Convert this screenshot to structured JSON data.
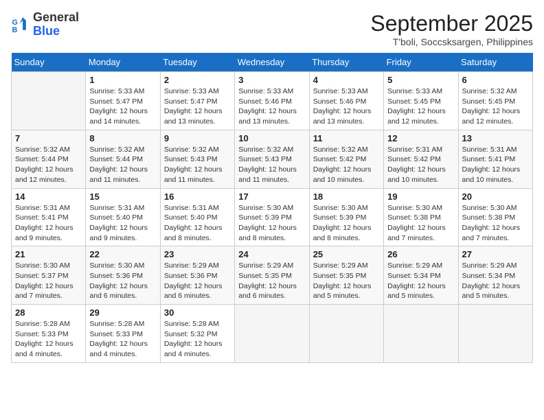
{
  "logo": {
    "line1": "General",
    "line2": "Blue"
  },
  "title": "September 2025",
  "subtitle": "T'boli, Soccsksargen, Philippines",
  "headers": [
    "Sunday",
    "Monday",
    "Tuesday",
    "Wednesday",
    "Thursday",
    "Friday",
    "Saturday"
  ],
  "weeks": [
    [
      {
        "day": "",
        "info": ""
      },
      {
        "day": "1",
        "info": "Sunrise: 5:33 AM\nSunset: 5:47 PM\nDaylight: 12 hours\nand 14 minutes."
      },
      {
        "day": "2",
        "info": "Sunrise: 5:33 AM\nSunset: 5:47 PM\nDaylight: 12 hours\nand 13 minutes."
      },
      {
        "day": "3",
        "info": "Sunrise: 5:33 AM\nSunset: 5:46 PM\nDaylight: 12 hours\nand 13 minutes."
      },
      {
        "day": "4",
        "info": "Sunrise: 5:33 AM\nSunset: 5:46 PM\nDaylight: 12 hours\nand 13 minutes."
      },
      {
        "day": "5",
        "info": "Sunrise: 5:33 AM\nSunset: 5:45 PM\nDaylight: 12 hours\nand 12 minutes."
      },
      {
        "day": "6",
        "info": "Sunrise: 5:32 AM\nSunset: 5:45 PM\nDaylight: 12 hours\nand 12 minutes."
      }
    ],
    [
      {
        "day": "7",
        "info": "Sunrise: 5:32 AM\nSunset: 5:44 PM\nDaylight: 12 hours\nand 12 minutes."
      },
      {
        "day": "8",
        "info": "Sunrise: 5:32 AM\nSunset: 5:44 PM\nDaylight: 12 hours\nand 11 minutes."
      },
      {
        "day": "9",
        "info": "Sunrise: 5:32 AM\nSunset: 5:43 PM\nDaylight: 12 hours\nand 11 minutes."
      },
      {
        "day": "10",
        "info": "Sunrise: 5:32 AM\nSunset: 5:43 PM\nDaylight: 12 hours\nand 11 minutes."
      },
      {
        "day": "11",
        "info": "Sunrise: 5:32 AM\nSunset: 5:42 PM\nDaylight: 12 hours\nand 10 minutes."
      },
      {
        "day": "12",
        "info": "Sunrise: 5:31 AM\nSunset: 5:42 PM\nDaylight: 12 hours\nand 10 minutes."
      },
      {
        "day": "13",
        "info": "Sunrise: 5:31 AM\nSunset: 5:41 PM\nDaylight: 12 hours\nand 10 minutes."
      }
    ],
    [
      {
        "day": "14",
        "info": "Sunrise: 5:31 AM\nSunset: 5:41 PM\nDaylight: 12 hours\nand 9 minutes."
      },
      {
        "day": "15",
        "info": "Sunrise: 5:31 AM\nSunset: 5:40 PM\nDaylight: 12 hours\nand 9 minutes."
      },
      {
        "day": "16",
        "info": "Sunrise: 5:31 AM\nSunset: 5:40 PM\nDaylight: 12 hours\nand 8 minutes."
      },
      {
        "day": "17",
        "info": "Sunrise: 5:30 AM\nSunset: 5:39 PM\nDaylight: 12 hours\nand 8 minutes."
      },
      {
        "day": "18",
        "info": "Sunrise: 5:30 AM\nSunset: 5:39 PM\nDaylight: 12 hours\nand 8 minutes."
      },
      {
        "day": "19",
        "info": "Sunrise: 5:30 AM\nSunset: 5:38 PM\nDaylight: 12 hours\nand 7 minutes."
      },
      {
        "day": "20",
        "info": "Sunrise: 5:30 AM\nSunset: 5:38 PM\nDaylight: 12 hours\nand 7 minutes."
      }
    ],
    [
      {
        "day": "21",
        "info": "Sunrise: 5:30 AM\nSunset: 5:37 PM\nDaylight: 12 hours\nand 7 minutes."
      },
      {
        "day": "22",
        "info": "Sunrise: 5:30 AM\nSunset: 5:36 PM\nDaylight: 12 hours\nand 6 minutes."
      },
      {
        "day": "23",
        "info": "Sunrise: 5:29 AM\nSunset: 5:36 PM\nDaylight: 12 hours\nand 6 minutes."
      },
      {
        "day": "24",
        "info": "Sunrise: 5:29 AM\nSunset: 5:35 PM\nDaylight: 12 hours\nand 6 minutes."
      },
      {
        "day": "25",
        "info": "Sunrise: 5:29 AM\nSunset: 5:35 PM\nDaylight: 12 hours\nand 5 minutes."
      },
      {
        "day": "26",
        "info": "Sunrise: 5:29 AM\nSunset: 5:34 PM\nDaylight: 12 hours\nand 5 minutes."
      },
      {
        "day": "27",
        "info": "Sunrise: 5:29 AM\nSunset: 5:34 PM\nDaylight: 12 hours\nand 5 minutes."
      }
    ],
    [
      {
        "day": "28",
        "info": "Sunrise: 5:28 AM\nSunset: 5:33 PM\nDaylight: 12 hours\nand 4 minutes."
      },
      {
        "day": "29",
        "info": "Sunrise: 5:28 AM\nSunset: 5:33 PM\nDaylight: 12 hours\nand 4 minutes."
      },
      {
        "day": "30",
        "info": "Sunrise: 5:28 AM\nSunset: 5:32 PM\nDaylight: 12 hours\nand 4 minutes."
      },
      {
        "day": "",
        "info": ""
      },
      {
        "day": "",
        "info": ""
      },
      {
        "day": "",
        "info": ""
      },
      {
        "day": "",
        "info": ""
      }
    ]
  ]
}
